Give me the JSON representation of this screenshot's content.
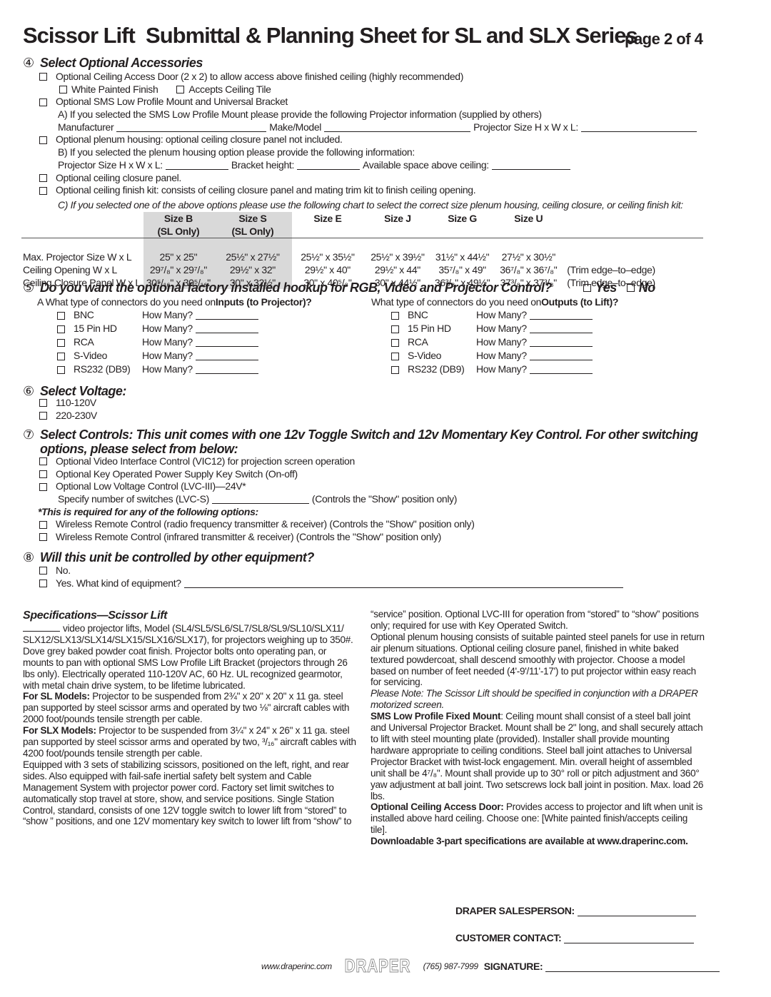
{
  "header": {
    "title": "Scissor Lift  Submittal & Planning Sheet for SL and SLX Series",
    "page": "page 2 of 4"
  },
  "s4": {
    "num": "④",
    "title": "Select Optional Accessories",
    "door": "Optional Ceiling Access Door (2 x 2) to allow access above finished ceiling (highly recommended)",
    "white": "White Painted Finish",
    "tile": "Accepts Ceiling Tile",
    "sms": "Optional SMS Low Profile Mount and Universal Bracket",
    "a": "A)  If you selected the SMS Low Profile Mount please provide the following Projector information (supplied by others)",
    "manufacturer": "Manufacturer",
    "make": "Make/Model",
    "psize": "Projector Size H x W x L:",
    "plenum": "Optional plenum housing: optional ceiling closure panel not included.",
    "b": "B)  If you selected the plenum housing option please provide the following information:",
    "psize2": "Projector Size H x W x L:",
    "bracket": "Bracket height:",
    "space": "Available space above ceiling:",
    "closure": "Optional ceiling closure panel.",
    "finish": "Optional ceiling finish kit: consists of ceiling closure panel and mating trim kit to finish ceiling opening.",
    "c": "C)  If you selected one of the above options please use the following chart to select the correct size plenum housing, ceiling closure, or ceiling finish kit:"
  },
  "size_table": {
    "headers": [
      {
        "name": "Size B",
        "sub": "(SL Only)"
      },
      {
        "name": "Size S",
        "sub": "(SL Only)"
      },
      {
        "name": "Size E",
        "sub": ""
      },
      {
        "name": "Size J",
        "sub": ""
      },
      {
        "name": "Size G",
        "sub": ""
      },
      {
        "name": "Size U",
        "sub": ""
      }
    ],
    "rows": [
      {
        "label": "Max. Projector Size W x L",
        "cells": [
          "25\" x 25\"",
          "25½\" x 27½\"",
          "25½\" x 35½\"",
          "25½\" x 39½\"",
          "31½\" x 44½\"",
          "27½\" x 30½\""
        ],
        "note": ""
      },
      {
        "label": "Ceiling Opening  W x L",
        "cells": [
          "29⁷/₈\" x 29⁷/₈\"",
          "29½\" x 32\"",
          "29½\" x 40\"",
          "29½\" x 44\"",
          "35⁷/₈\" x 49\"",
          "36⁷/₈\" x 36⁷/₈\""
        ],
        "note": "(Trim edge–to–edge)"
      },
      {
        "label": "Ceiling Closure Panel  W x L",
        "cells": [
          "30⁵/₁₆\" x 30⁵/₁₆\"",
          "30\" x 32½\"",
          "30\" x 40⁵/₈\"",
          "30\" x 44½\"",
          "36³/₈\" x 49½\"",
          "37³/₈\" x 37³/₈\""
        ],
        "note": "(Trim edge–to–edge)"
      }
    ]
  },
  "s5": {
    "num": "⑤",
    "title": "Do you want the optional factory installed hookup for RGB, Video and Projector Control?",
    "yes": "Yes",
    "no": "No",
    "in_q_pre": "A   What type of connectors do you need on ",
    "in_q_b": "Inputs (to Projector)?",
    "out_q_pre": "What type of connectors do you need on ",
    "out_q_b": "Outputs (to Lift)?",
    "connectors": [
      "BNC",
      "15 Pin HD",
      "RCA",
      "S-Video",
      "RS232 (DB9)"
    ],
    "how": "How Many?"
  },
  "s6": {
    "num": "⑥",
    "title": "Select Voltage:",
    "options": [
      "110-120V",
      "220-230V"
    ]
  },
  "s7": {
    "num": "⑦",
    "title1": "Select Controls: This unit comes with one 12v Toggle Switch and 12v Momentary Key Control. For other switching",
    "title2": "options, please select from below:",
    "vic": "Optional Video Interface Control (VIC12) for projection screen operation",
    "key": "Optional Key Operated Power Supply Key Switch (On-off)",
    "lvc": "Optional Low Voltage Control (LVC-III)—24V*",
    "spec": "Specify number of switches (LVC-S)",
    "show": "(Controls the \"Show\" position only)",
    "req": "*This is required for any of the following options:",
    "rf": "Wireless Remote Control (radio frequency transmitter & receiver) (Controls the \"Show\" position only)",
    "ir": "Wireless Remote Control (infrared transmitter & receiver) (Controls the \"Show\" position only)"
  },
  "s8": {
    "num": "⑧",
    "title": "Will this unit be controlled by other equipment?",
    "no": "No.",
    "yes": "Yes. What kind of equipment?"
  },
  "specs": {
    "title": "Specifications—Scissor Lift",
    "p1": "video projector lifts, Model (SL4/SL5/SL6/SL7/SL8/SL9/SL10/SLX11/ SLX12/SLX13/SLX14/SLX15/SLX16/SLX17), for projectors weighing up to 350#. Dove grey baked powder coat finish. Projector bolts onto operating pan, or mounts to pan with optional SMS Low Profile Lift Bracket (projectors through 26 lbs only). Electrically operated 110-120V AC, 60 Hz. UL recognized gearmotor, with metal chain drive system, to be lifetime lubricated.",
    "sl_b": "For SL Models:",
    "sl": " Projector to be suspended from 2¾\" x 20\" x 20\" x 11 ga. steel pan supported by steel scissor arms and operated by two ⅛\" aircraft cables with 2000 foot/pounds tensile strength per cable.",
    "slx_b": "For SLX Models:",
    "slx": " Projector to be suspended from 3¼\" x 24\" x 26\" x 11 ga. steel pan supported by steel scissor arms and operated by two, ³/₁₆\" aircraft cables with 4200 foot/pounds tensile strength per cable.",
    "p2": "Equipped with 3 sets of stabilizing scissors, positioned on the left, right, and rear sides. Also equipped with fail-safe inertial safety belt system and Cable Management System with projector power cord. Factory set limit switches to automatically stop travel at store, show, and service positions. Single Station Control, standard, consists of one 12V toggle switch to lower lift from “stored” to “show ” positions, and one 12V momentary key switch to lower lift from “show” to",
    "p3": "“service” position. Optional LVC-III for operation from “stored” to “show” positions only; required for use with Key Operated Switch.",
    "p4": "Optional plenum housing consists of suitable painted steel panels for use in return air plenum situations. Optional ceiling closure panel, finished in white baked textured powdercoat, shall descend smoothly with projector. Choose a model based on number of feet needed (4'-9'/11'-17') to put projector within easy reach for servicing.",
    "note": "Please Note: The Scissor Lift should be specified in conjunction with a DRAPER motorized screen.",
    "sms_b": "SMS Low Profile Fixed Mount",
    "sms": ": Ceiling mount shall consist of a steel ball joint and Universal Projector Bracket. Mount shall be 2\" long, and shall securely attach to lift with steel mounting plate (provided). Installer shall provide mounting hardware appropriate to ceiling conditions. Steel ball joint attaches to Universal Projector Bracket with twist-lock engagement. Min. overall height of assembled unit shall be 4⁷/₈\". Mount shall provide up to 30° roll or pitch adjustment and 360° yaw adjustment at ball joint. Two setscrews lock ball joint in position. Max. load 26 lbs.",
    "door_b": "Optional Ceiling Access Door:",
    "door": " Provides access to projector and lift when unit is installed above hard ceiling. Choose one: [White painted finish/accepts ceiling tile].",
    "download": "Downloadable 3-part specifications are available at www.draperinc.com."
  },
  "footer": {
    "salesperson": "DRAPER SALESPERSON:",
    "contact": "CUSTOMER CONTACT:",
    "signature": "SIGNATURE:",
    "url": "www.draperinc.com",
    "logo": "DRAPER",
    "phone": "(765) 987-7999"
  }
}
